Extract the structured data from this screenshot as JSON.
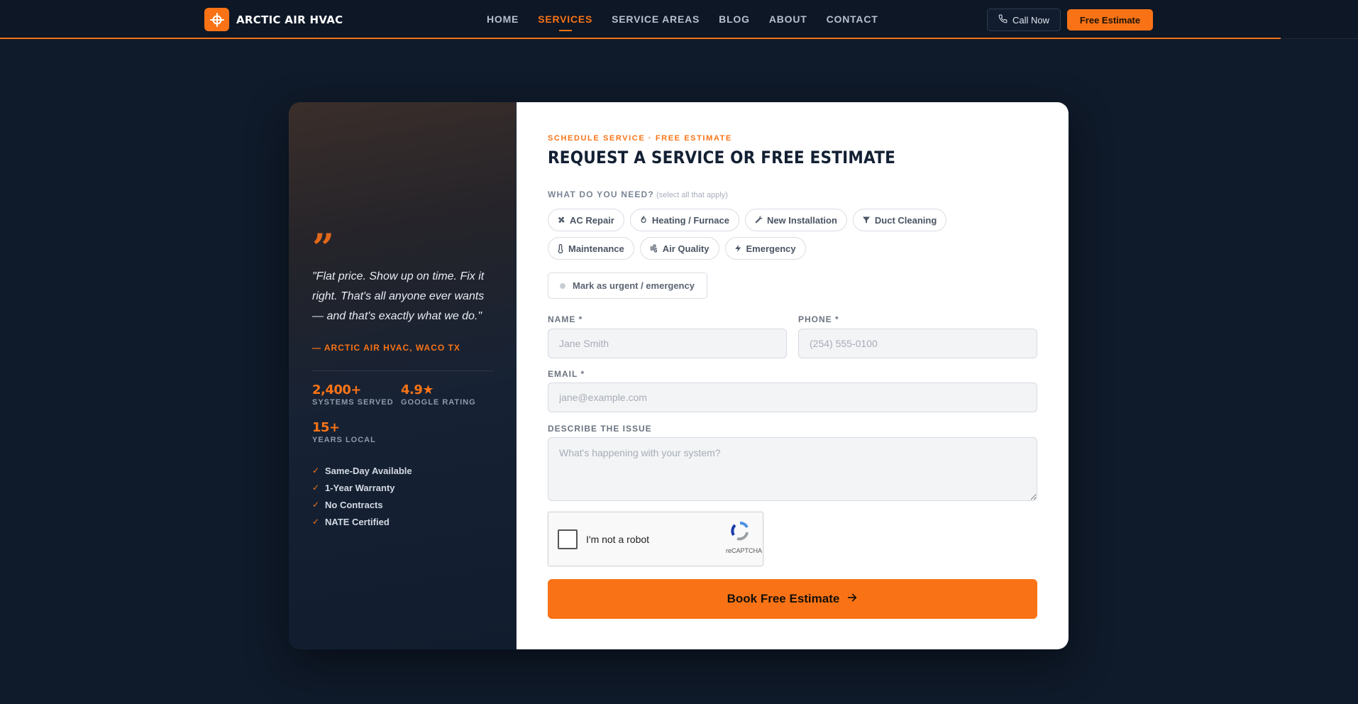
{
  "brand": {
    "name": "ARCTIC AIR HVAC",
    "accent": "#f97316",
    "background": "#0f1a2a"
  },
  "nav": {
    "items": [
      {
        "label": "HOME",
        "active": false
      },
      {
        "label": "SERVICES",
        "active": true
      },
      {
        "label": "SERVICE AREAS",
        "active": false
      },
      {
        "label": "BLOG",
        "active": false
      },
      {
        "label": "ABOUT",
        "active": false
      },
      {
        "label": "CONTACT",
        "active": false
      }
    ],
    "call_label": "Call Now",
    "estimate_label": "Free Estimate"
  },
  "testimonial": {
    "quote": "\"Flat price. Show up on time. Fix it right. That's all anyone ever wants — and that's exactly what we do.\"",
    "author": "— ARCTIC AIR HVAC, WACO TX",
    "stats": [
      {
        "value": "2,400+",
        "label": "SYSTEMS SERVED"
      },
      {
        "value": "4.9★",
        "label": "GOOGLE RATING"
      },
      {
        "value": "15+",
        "label": "YEARS LOCAL"
      }
    ],
    "checks": [
      "Same-Day Available",
      "1-Year Warranty",
      "No Contracts",
      "NATE Certified"
    ]
  },
  "form": {
    "eyebrow": "SCHEDULE SERVICE · FREE ESTIMATE",
    "title": "REQUEST A SERVICE OR FREE ESTIMATE",
    "need_label": "WHAT DO YOU NEED?",
    "need_hint": "(select all that apply)",
    "services": [
      {
        "label": "AC Repair",
        "icon": "fan-icon"
      },
      {
        "label": "Heating / Furnace",
        "icon": "flame-icon"
      },
      {
        "label": "New Installation",
        "icon": "wrench-icon"
      },
      {
        "label": "Duct Cleaning",
        "icon": "filter-icon"
      },
      {
        "label": "Maintenance",
        "icon": "thermometer-icon"
      },
      {
        "label": "Air Quality",
        "icon": "wind-icon"
      },
      {
        "label": "Emergency",
        "icon": "bolt-icon"
      }
    ],
    "urgent_label": "Mark as urgent / emergency",
    "name_label": "NAME *",
    "name_placeholder": "Jane Smith",
    "phone_label": "PHONE *",
    "phone_placeholder": "(254) 555-0100",
    "email_label": "EMAIL *",
    "email_placeholder": "jane@example.com",
    "issue_label": "DESCRIBE THE ISSUE",
    "issue_placeholder": "What's happening with your system?",
    "captcha_label": "I'm not a robot",
    "captcha_brand": "reCAPTCHA",
    "submit_label": "Book Free Estimate"
  }
}
